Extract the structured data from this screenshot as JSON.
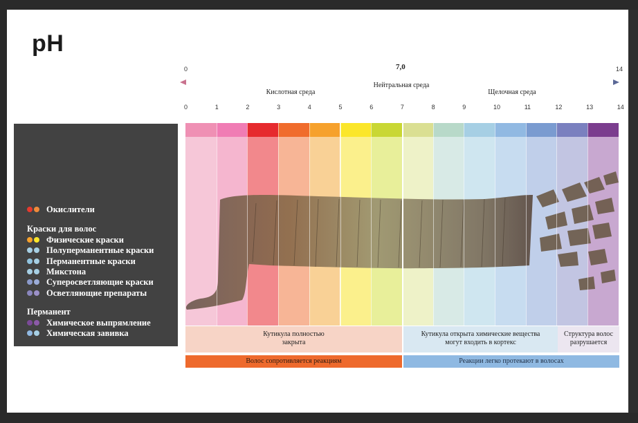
{
  "title": "pH",
  "scale": {
    "top_start": "0",
    "top_neutral": "7,0",
    "top_end": "14",
    "ticks": [
      "0",
      "1",
      "2",
      "3",
      "4",
      "5",
      "6",
      "7",
      "8",
      "9",
      "10",
      "11",
      "12",
      "13",
      "14"
    ],
    "zones": {
      "acid": "Кислотная среда",
      "neutral": "Нейтральная среда",
      "alkaline": "Щелочная среда"
    }
  },
  "band_colors": [
    "#ef90b4",
    "#f07cb4",
    "#e62a2e",
    "#f06c2c",
    "#f6a12c",
    "#fbe62a",
    "#c9d734",
    "#dadf92",
    "#b8d9c9",
    "#a6cfe4",
    "#91b9e2",
    "#7a9bd0",
    "#7a80bf",
    "#7b3d8e"
  ],
  "column_colors": [
    "#f6c7d8",
    "#f5b6cf",
    "#f2888c",
    "#f7b596",
    "#f9d196",
    "#fbf08c",
    "#e8ef9a",
    "#eef2c8",
    "#d8eae6",
    "#cfe6f0",
    "#c7dcf0",
    "#c0cfea",
    "#c2c5e2",
    "#c8a8d0"
  ],
  "legend": {
    "oxidizers": {
      "label": "Окислители",
      "colors": [
        "#e63a2e",
        "#f08a3a"
      ]
    },
    "dyes_head": "Краски для волос",
    "dyes": [
      {
        "label": "Физические краски",
        "colors": [
          "#f6a12c",
          "#fbe62a"
        ]
      },
      {
        "label": "Полуперманентные краски",
        "colors": [
          "#a6cfe4",
          "#a6cfe4"
        ]
      },
      {
        "label": "Перманентные краски",
        "colors": [
          "#91c4e0",
          "#a6cfe4"
        ]
      },
      {
        "label": "Микстона",
        "colors": [
          "#a6cfe4",
          "#a6cfe4"
        ]
      },
      {
        "label": "Суперосветляющие краски",
        "colors": [
          "#8b9acb",
          "#9bacd8"
        ]
      },
      {
        "label": "Осветляющие препараты",
        "colors": [
          "#8a86bd",
          "#9b90c8"
        ]
      }
    ],
    "perm_head": "Перманент",
    "perm": [
      {
        "label": "Химическое выпрямление",
        "colors": [
          "#7b4a98",
          "#8c5aa8"
        ]
      },
      {
        "label": "Химическая завивка",
        "colors": [
          "#91b9e2",
          "#a6cfe4"
        ]
      }
    ]
  },
  "boxes": {
    "closed": "Кутикула полностью закрыта",
    "open": "Кутикула открыта химические вещества могут входить в кортекс",
    "destroyed": "Структура волос разрушается"
  },
  "bars": {
    "resist": "Волос сопротивляется реакциям",
    "easy": "Реакции легко протекают в волосах"
  },
  "colors": {
    "resist_bar": "#ee6a2d",
    "easy_bar": "#8fb9e2",
    "legend_bg": "#424242"
  }
}
